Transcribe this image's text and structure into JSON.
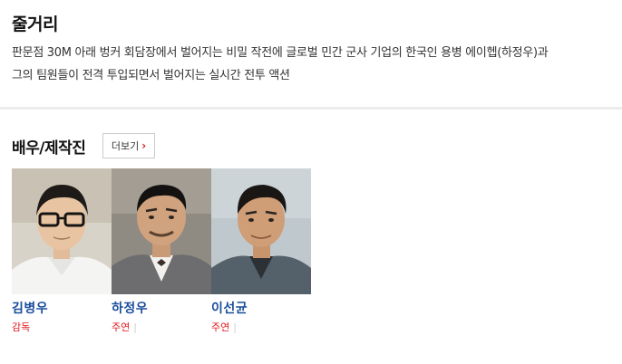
{
  "synopsis": {
    "title": "줄거리",
    "line1": "판문점 30M 아래 벙커 회담장에서 벌어지는 비밀 작전에 글로벌 민간 군사 기업의 한국인 용병 에이헵(하정우)과",
    "line2": "그의 팀원들이 전격 투입되면서 벌어지는 실시간 전투 액션"
  },
  "cast": {
    "title": "배우/제작진",
    "more_label": "더보기",
    "members": [
      {
        "name": "김병우",
        "role": "감독"
      },
      {
        "name": "하정우",
        "role": "주연"
      },
      {
        "name": "이선균",
        "role": "주연"
      }
    ]
  },
  "colors": {
    "name_blue": "#1a4e9c",
    "role_red": "#e0181d",
    "divider": "#ececec"
  },
  "icons": {
    "more_chevron": "chevron-right-icon"
  }
}
